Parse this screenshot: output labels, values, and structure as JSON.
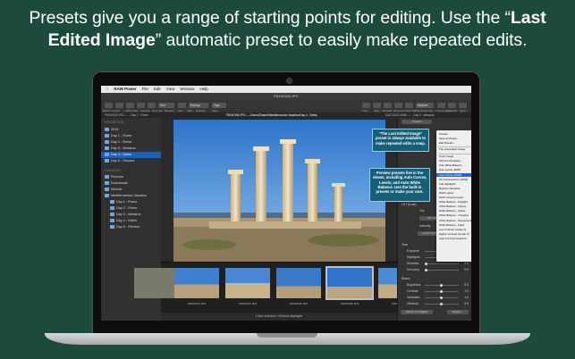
{
  "headline": {
    "line1": "Presets give you a range of starting points for editing. Use the “",
    "line1_bold": "Last",
    "line2_bold": "Edited Image",
    "line2": "” automatic preset to easily make repeated edits."
  },
  "colors": {
    "background": "#1c4a3c",
    "callout": "#185e76",
    "selection": "#1f5fb5",
    "menu_selection": "#2863d6"
  },
  "menubar": {
    "apple": "",
    "app": "RAW Power",
    "items": [
      "File",
      "Edit",
      "View",
      "Window",
      "Help"
    ]
  },
  "window": {
    "title": "P8190165.JPG",
    "toolbar_left": [
      "Batch Convert",
      "Add Folder",
      "Favorite",
      "Next Set",
      "Browser",
      "Sort",
      "Filter",
      "Ratings",
      "Tags"
    ],
    "sort_value": "Sort",
    "ratings_value": "Ratings",
    "tags_value": "Tags",
    "toolbar_right": [
      "Print",
      "Save",
      "Info/Edit",
      "Browser",
      "Unfold Tab",
      "Thumbnail Size",
      "Thumbnails",
      "Sidebar",
      "Quick"
    ],
    "size_value": "Medium"
  },
  "tabs": [
    "P8190529.JPG — ...Day 2 - Rome",
    "P8190165.JPG — /Users/Shared/Mediterranean Vacation/Day 4 - Delos",
    "DSC01322.ARW — ...Day 3 - Messina"
  ],
  "sidebar": {
    "favorites_header": "FAVORITES",
    "favorites": [
      {
        "label": "2018"
      },
      {
        "label": "Day 1 - Rome"
      },
      {
        "label": "Day 2 - Rome"
      },
      {
        "label": "Day 3 - Messina"
      },
      {
        "label": "Day 4 - Delos",
        "selected": true
      },
      {
        "label": "Day 5 - Rhodes"
      }
    ],
    "folders_header": "FOLDERS",
    "folders": [
      {
        "label": "Pictures"
      },
      {
        "label": "Downloads"
      },
      {
        "label": "Selects"
      },
      {
        "label": "Mediterranean Vacation"
      },
      {
        "label": "Day 1 - Rome"
      },
      {
        "label": "Day 2 - Rome"
      },
      {
        "label": "Day 3 - Messina"
      },
      {
        "label": "Day 4 - Delos"
      },
      {
        "label": "Day 5 - Rhodes"
      }
    ]
  },
  "filmstrip": {
    "thumbs": [
      "P8190134.JPG",
      "P8190140.JPG",
      "P8190150.JPG",
      "P8190165.JPG",
      "P8190170.JPG"
    ],
    "status": "1 item selected • 49 items displayed"
  },
  "panel": {
    "presets_label": "Presets",
    "lut_section": "LUT (Look)",
    "tint_label": "Tint",
    "no_luts": "No LUTs",
    "intensity_label": "Intensity",
    "import_luts": "Import LUTs...",
    "tone_section": "Tone",
    "tone_rows": [
      {
        "label": "Exposure",
        "value": "0.0"
      },
      {
        "label": "Highlights",
        "value": "1.0"
      },
      {
        "label": "Shadows",
        "value": "0.0"
      },
      {
        "label": "Recovery",
        "value": "0.0"
      }
    ],
    "basic_section": "Basics",
    "basic_rows": [
      {
        "label": "Brightness",
        "value": "0.0"
      },
      {
        "label": "Contrast",
        "value": "1.0"
      },
      {
        "label": "Saturation",
        "value": "1.0"
      },
      {
        "label": "Vibrancy",
        "value": "0.0"
      }
    ],
    "revert_button": "Revert to Original",
    "export_button": "Export..."
  },
  "dropdown": {
    "items": [
      "Presets",
      "Save as Preset...",
      "Edit Presets...",
      "",
      "The Last Edited Image",
      "",
      "Invert Image",
      "Infrared Simulation",
      "Auto White Balance",
      "Auto Levels (RGB)",
      "Auto Curves (RGB)",
      "Fix Overexposure (RAW)",
      "Add Highlights",
      "Brighten Shadows",
      "RAW Lighter",
      "RAW Underexposure",
      "White Balance - Daylight",
      "White Balance - Cloudy",
      "White Balance - Shade",
      "White Balance - Tungsten",
      "White Balance - Fluorescent",
      "White Balance - Flash",
      "Low Contrast (Grade 0)",
      "Higher Contrast (Grade 3)",
      "High Contrast (Grade 5)"
    ],
    "selected_index": 10
  },
  "callouts": [
    {
      "text": "“The Last Edited Image” preset is always available to make repeated edits a snap."
    },
    {
      "text": "Preview presets live in the viewer, including Auto Curves, Levels, and Auto White Balance. Use the built-in presets or make your own."
    }
  ]
}
